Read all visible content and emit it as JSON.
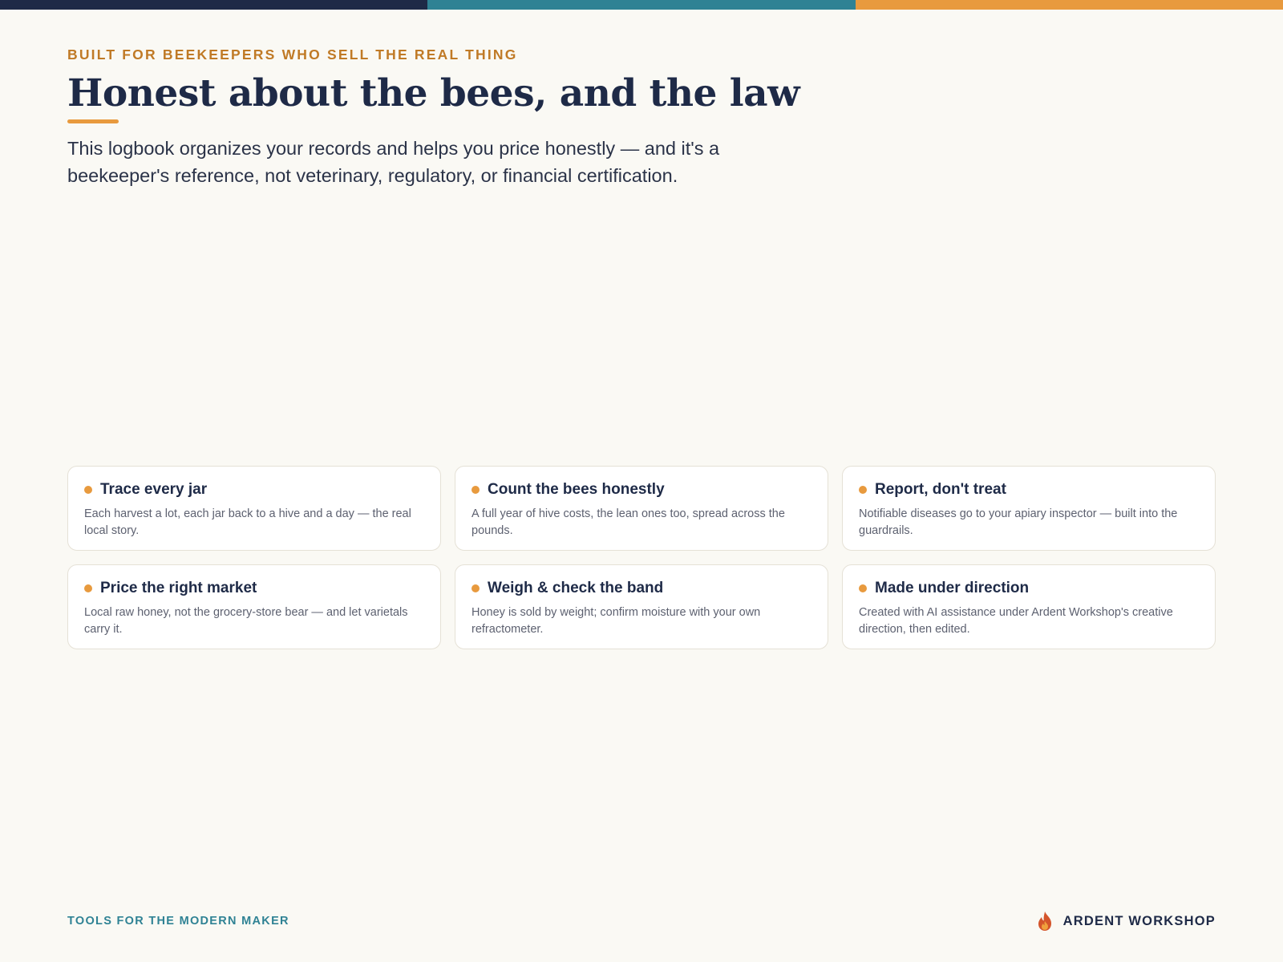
{
  "colors": {
    "navy": "#1e2a47",
    "teal": "#2f8294",
    "orange": "#e89a3e",
    "eyebrow": "#c07a26",
    "background": "#faf9f4"
  },
  "eyebrow": "BUILT FOR BEEKEEPERS WHO SELL THE REAL THING",
  "headline": "Honest about the bees, and the law",
  "lead": "This logbook organizes your records and helps you price honestly — and it's a beekeeper's reference, not veterinary, regulatory, or financial certification.",
  "cards": [
    {
      "title": "Trace every jar",
      "body": "Each harvest a lot, each jar back to a hive and a day — the real local story."
    },
    {
      "title": "Count the bees honestly",
      "body": "A full year of hive costs, the lean ones too, spread across the pounds."
    },
    {
      "title": "Report, don't treat",
      "body": "Notifiable diseases go to your apiary inspector — built into the guardrails."
    },
    {
      "title": "Price the right market",
      "body": "Local raw honey, not the grocery-store bear — and let varietals carry it."
    },
    {
      "title": "Weigh & check the band",
      "body": "Honey is sold by weight; confirm moisture with your own refractometer."
    },
    {
      "title": "Made under direction",
      "body": "Created with AI assistance under Ardent Workshop's creative direction, then edited."
    }
  ],
  "footer": {
    "tagline": "TOOLS FOR THE MODERN MAKER",
    "brand": "ARDENT WORKSHOP",
    "brand_icon": "flame-icon"
  }
}
